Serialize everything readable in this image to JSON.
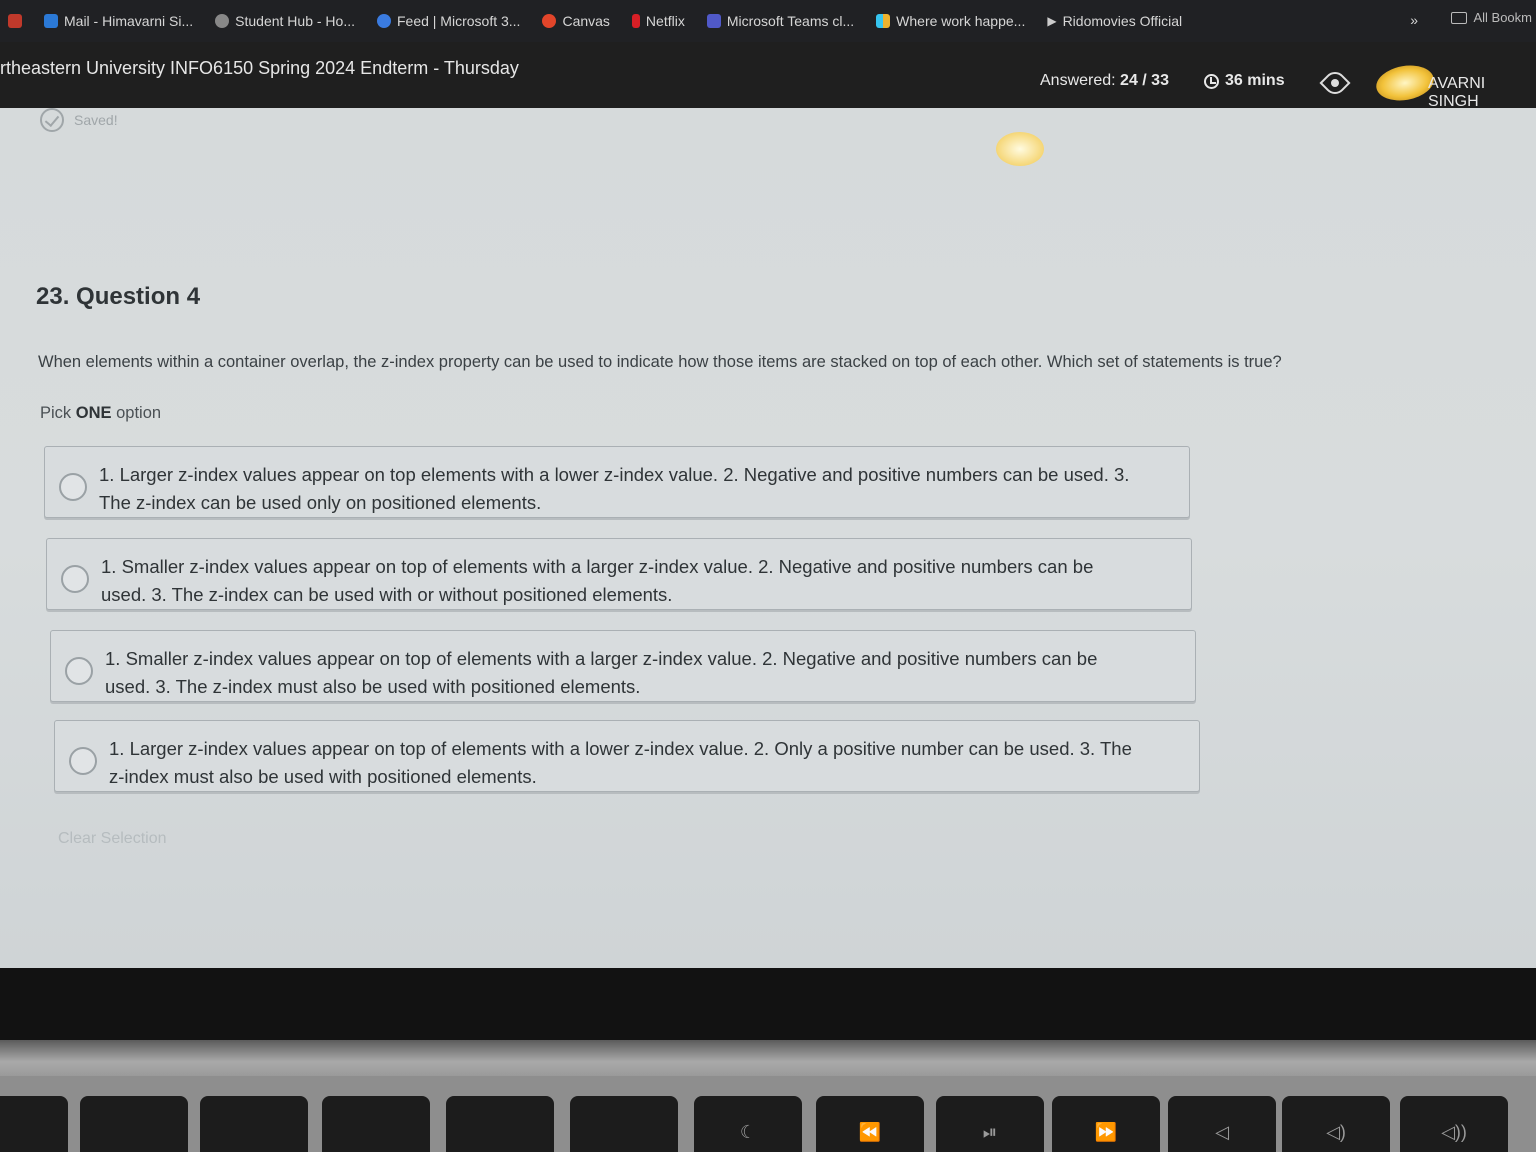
{
  "bookmarks": {
    "items": [
      {
        "label": "Mail - Himavarni Si...",
        "color": "#2b79d6"
      },
      {
        "label": "Student Hub - Ho...",
        "color": "#888888"
      },
      {
        "label": "Feed | Microsoft 3...",
        "color": "#3a7be0"
      },
      {
        "label": "Canvas",
        "color": "#e2452a"
      },
      {
        "label": "Netflix",
        "color": "#d81f26"
      },
      {
        "label": "Microsoft Teams cl...",
        "color": "#5059c9"
      },
      {
        "label": "Where work happe...",
        "color": "#e8a21f"
      },
      {
        "label": "Ridomovies Official",
        "color": "#cccccc"
      }
    ],
    "more": "»",
    "all_bookmarks": "All Bookm"
  },
  "header": {
    "exam_title": "rtheastern University INFO6150 Spring 2024 Endterm - Thursday",
    "answered_label": "Answered:",
    "answered_value": "24 / 33",
    "timer": "36 mins",
    "username": "AVARNI SINGH"
  },
  "status": {
    "saved": "Saved!"
  },
  "question": {
    "title": "23. Question 4",
    "text": "When elements within a container overlap, the z-index property can be used to indicate how those items are stacked on top of each other. Which set of statements is true?",
    "hint_prefix": "Pick",
    "hint_bold": "ONE",
    "hint_suffix": "option",
    "options": [
      {
        "text": "1. Larger z-index values appear on top elements with a lower z-index value. 2. Negative and positive numbers can be used. 3. The z-index can be used only on positioned elements."
      },
      {
        "text": "1. Smaller z-index values appear on top of elements with a larger z-index value. 2. Negative and positive numbers can be used. 3. The z-index can be used with or without positioned elements."
      },
      {
        "text": "1. Smaller z-index values appear on top of elements with a larger z-index value. 2. Negative and positive numbers can be used. 3. The z-index must also be used with positioned elements."
      },
      {
        "text": "1. Larger z-index values appear on top of elements with a lower z-index value. 2. Only a positive number can be used. 3. The z-index must also be used with positioned elements."
      }
    ],
    "clear_selection": "Clear Selection"
  },
  "keyboard": {
    "keys": [
      "",
      "",
      "",
      "",
      "",
      "",
      "☾",
      "⏪",
      "⏯",
      "⏩",
      "◁",
      "◁)",
      "◁))"
    ]
  }
}
